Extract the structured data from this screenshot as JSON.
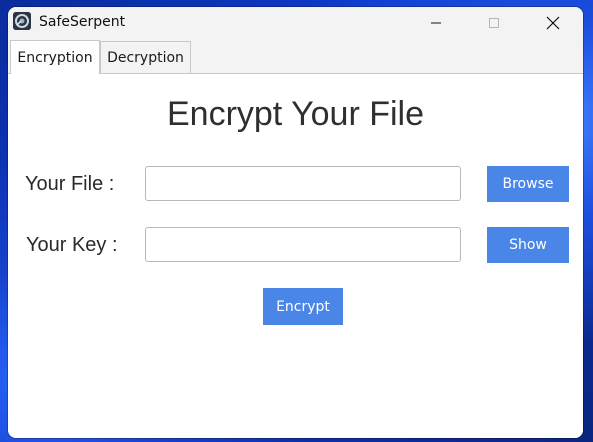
{
  "window": {
    "title": "SafeSerpent",
    "icon": "serpent-app-icon",
    "controls": [
      "minimize-icon",
      "maximize-icon",
      "close-icon"
    ]
  },
  "tabs": [
    {
      "label": "Encryption",
      "active": true
    },
    {
      "label": "Decryption",
      "active": false
    }
  ],
  "encryption": {
    "heading": "Encrypt Your File",
    "file_label": "Your File :",
    "file_value": "",
    "key_label": "Your Key :",
    "key_value": "",
    "browse_label": "Browse",
    "show_label": "Show",
    "encrypt_label": "Encrypt"
  },
  "colors": {
    "accent": "#4a86e8",
    "titlebar": "#f3f3f3",
    "wallpaper": "#0e3ad0"
  }
}
